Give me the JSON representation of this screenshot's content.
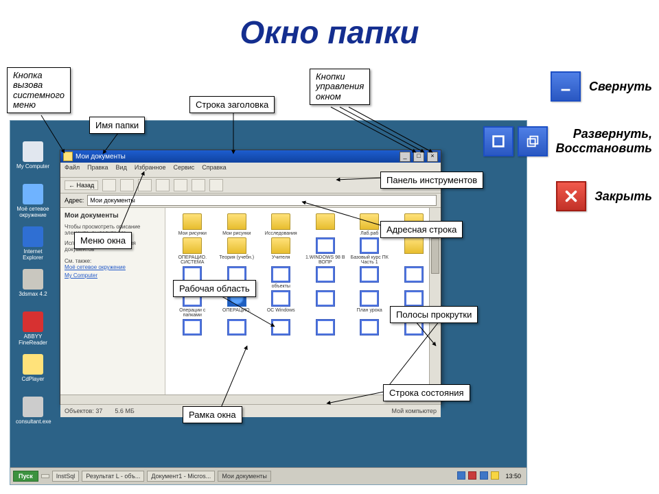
{
  "title": "Окно папки",
  "callouts": {
    "sysmenu": "Кнопка\nвызова\nсистемного\nменю",
    "foldername": "Имя папки",
    "titlebar": "Строка заголовка",
    "ctrlbtn": "Кнопки\nуправления\nокном",
    "toolbar": "Панель инструментов",
    "addrbar": "Адресная строка",
    "winmenu": "Меню окна",
    "work": "Рабочая область",
    "scroll": "Полосы прокрутки",
    "statusbar": "Строка состояния",
    "frame": "Рамка окна"
  },
  "legend": {
    "minimize": "Свернуть",
    "maxrest": "Развернуть,\nВосстановить",
    "close": "Закрыть"
  },
  "desktop_icons": [
    {
      "label": "My Computer",
      "color": "#e1e7ef"
    },
    {
      "label": "Моё сетевое окружение",
      "color": "#6fb3ff"
    },
    {
      "label": "Internet Explorer",
      "color": "#2f6fd3"
    },
    {
      "label": "3dsmax 4.2",
      "color": "#c9c7bf"
    },
    {
      "label": "ABBYY FineReader",
      "color": "#d73131"
    },
    {
      "label": "CdPlayer",
      "color": "#ffe27a"
    },
    {
      "label": "consultant.exe",
      "color": "#cccccc"
    }
  ],
  "window": {
    "title": "Мои документы",
    "menu": [
      "Файл",
      "Правка",
      "Вид",
      "Избранное",
      "Сервис",
      "Справка"
    ],
    "back": "← Назад",
    "addr_label": "Адрес:",
    "addr_value": "Мои документы",
    "left_head": "Мои документы",
    "left_note1": "Чтобы просмотреть описание элемента, выделите его.",
    "left_note2": "Используется для хранения документов",
    "left_see": "См. также:",
    "left_link1": "Моё сетевое окружение",
    "left_link2": "My Computer",
    "files": [
      {
        "t": "fold",
        "n": "Мои рисунки"
      },
      {
        "t": "fold",
        "n": "Мои рисунки"
      },
      {
        "t": "fold",
        "n": "Исследования"
      },
      {
        "t": "fold",
        "n": ""
      },
      {
        "t": "fold",
        "n": "Лаб.раб"
      },
      {
        "t": "fold",
        "n": "ICQ Lite"
      },
      {
        "t": "fold",
        "n": "ОПЕРАЦИО. СИСТЕМА"
      },
      {
        "t": "fold",
        "n": "Теория (учебн.)"
      },
      {
        "t": "fold",
        "n": "Учителя"
      },
      {
        "t": "doc",
        "n": "1.WINDOWS 98 В ВОПР"
      },
      {
        "t": "doc",
        "n": "Базовый курс ПК Часть 1"
      },
      {
        "t": "fold",
        "n": ""
      },
      {
        "t": "doc",
        "n": ""
      },
      {
        "t": "doc",
        "n": ""
      },
      {
        "t": "doc",
        "n": "объекты"
      },
      {
        "t": "doc",
        "n": ""
      },
      {
        "t": "doc",
        "n": ""
      },
      {
        "t": "doc",
        "n": ""
      },
      {
        "t": "doc",
        "n": "Операции с папками"
      },
      {
        "t": "ie",
        "n": "ОПЕРАЦИО."
      },
      {
        "t": "doc",
        "n": "ОС Windows"
      },
      {
        "t": "doc",
        "n": ""
      },
      {
        "t": "doc",
        "n": "План урока"
      },
      {
        "t": "doc",
        "n": ""
      },
      {
        "t": "doc",
        "n": ""
      },
      {
        "t": "doc",
        "n": ""
      },
      {
        "t": "doc",
        "n": ""
      },
      {
        "t": "doc",
        "n": ""
      },
      {
        "t": "doc",
        "n": ""
      },
      {
        "t": "doc",
        "n": ""
      }
    ],
    "status_objects": "Объектов: 37",
    "status_size": "5.6 МБ",
    "status_loc": "Мой компьютер"
  },
  "taskbar": {
    "start": "Пуск",
    "items": [
      "",
      "InstSql",
      "Результат L - объ...",
      "Документ1 - Micros...",
      "Мои документы"
    ],
    "time": "13:50"
  }
}
